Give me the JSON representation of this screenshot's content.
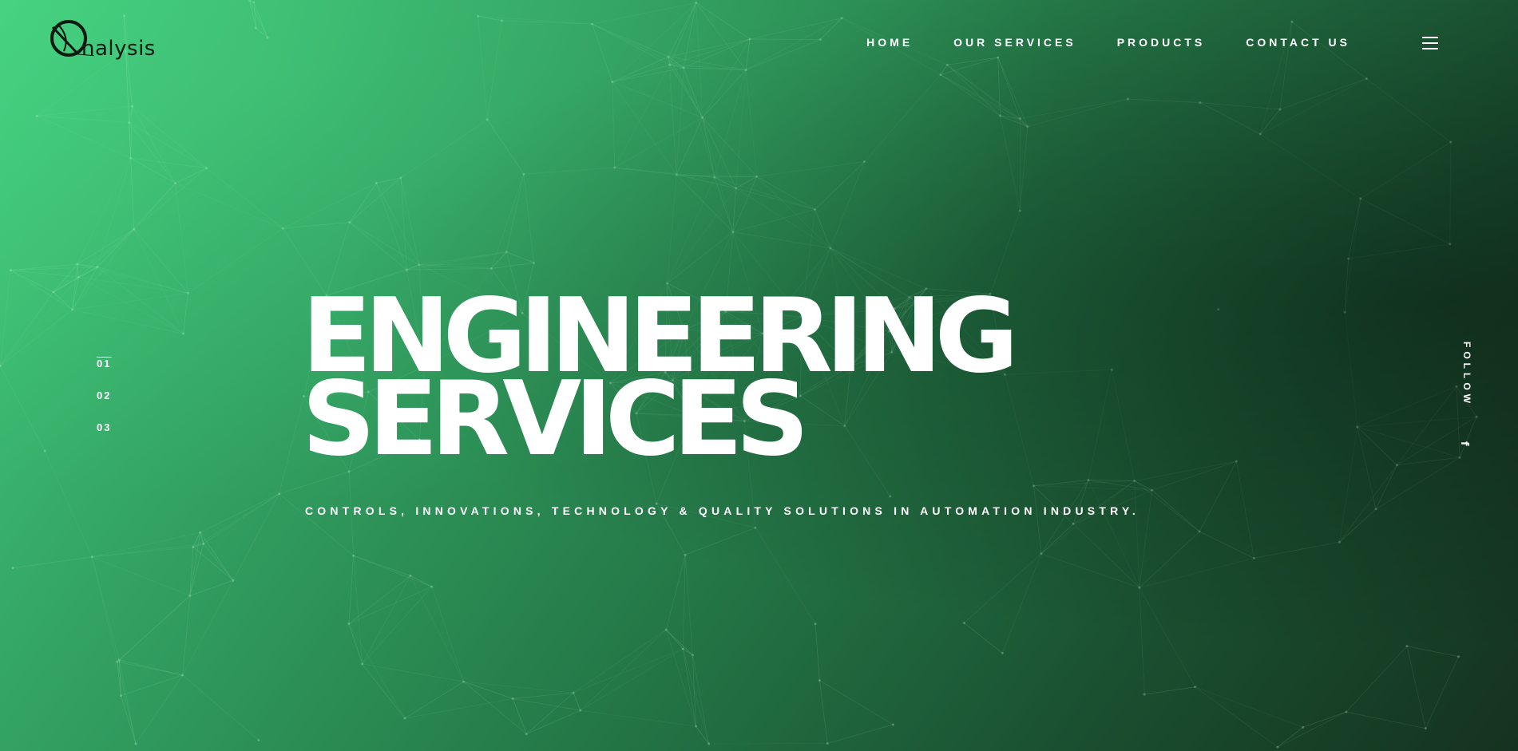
{
  "brand": {
    "logo_text": "nalysis",
    "logo_icon": "Q-swirl-logo"
  },
  "nav": {
    "items": [
      {
        "label": "HOME"
      },
      {
        "label": "OUR SERVICES"
      },
      {
        "label": "PRODUCTS"
      },
      {
        "label": "CONTACT US"
      }
    ],
    "menu_icon": "hamburger-icon"
  },
  "slider": {
    "items": [
      {
        "label": "01",
        "active": true
      },
      {
        "label": "02",
        "active": false
      },
      {
        "label": "03",
        "active": false
      }
    ]
  },
  "hero": {
    "headline_line1": "ENGINEERING",
    "headline_line2": "SERVICES",
    "subtitle": "CONTROLS, INNOVATIONS, TECHNOLOGY & QUALITY SOLUTIONS IN AUTOMATION INDUSTRY."
  },
  "social": {
    "follow_label": "FOLLOW",
    "facebook_glyph": "f",
    "facebook_icon": "facebook-icon"
  },
  "colors": {
    "gradient_light": "#44cf7f",
    "gradient_dark": "#15321f",
    "text": "#ffffff"
  }
}
